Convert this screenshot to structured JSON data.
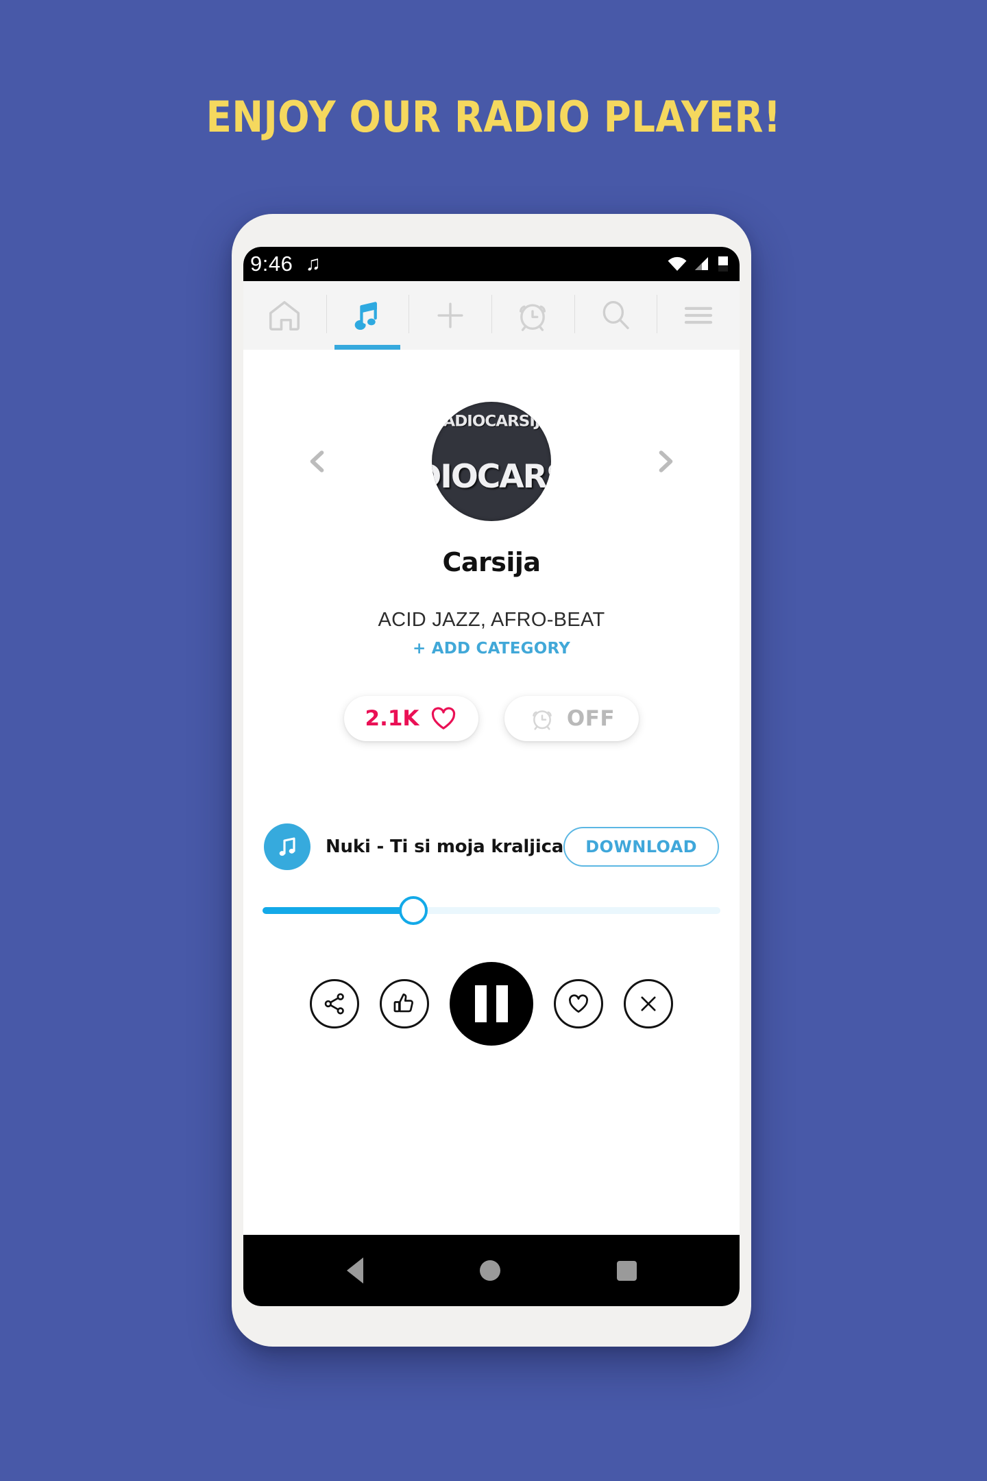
{
  "page": {
    "background_color": "#4859a8",
    "headline": "ENJOY OUR RADIO PLAYER!",
    "headline_color": "#f5d85e"
  },
  "statusbar": {
    "time": "9:46",
    "music_glyph": "♫",
    "icons": [
      "wifi-icon",
      "signal-icon",
      "battery-icon"
    ]
  },
  "tabbar": {
    "accent_color": "#36a9dd",
    "tabs": [
      {
        "name": "home",
        "icon": "home-icon",
        "active": false
      },
      {
        "name": "music",
        "icon": "music-note-icon",
        "active": true
      },
      {
        "name": "add",
        "icon": "plus-icon",
        "active": false
      },
      {
        "name": "alarm",
        "icon": "alarm-clock-icon",
        "active": false
      },
      {
        "name": "search",
        "icon": "search-icon",
        "active": false
      },
      {
        "name": "menu",
        "icon": "hamburger-menu-icon",
        "active": false
      }
    ]
  },
  "station": {
    "artwork_top_text": "RADIOCARSIJA",
    "artwork_main_text": "DIOCARS",
    "name": "Carsija",
    "categories": "ACID JAZZ, AFRO-BEAT",
    "add_category_label": "+ ADD CATEGORY",
    "add_category_color": "#41a8d8",
    "prev_icon": "chevron-left-icon",
    "next_icon": "chevron-right-icon"
  },
  "chips": {
    "like": {
      "count": "2.1K",
      "icon": "heart-outline-icon",
      "color": "#ea1055"
    },
    "alarm": {
      "label": "OFF",
      "icon": "alarm-clock-icon",
      "color": "#b9b9b9"
    }
  },
  "now_playing": {
    "icon": "music-note-circle-icon",
    "icon_color": "#36aadd",
    "title": "Nuki - Ti si moja kraljica",
    "download_label": "DOWNLOAD",
    "download_color": "#3fa7da"
  },
  "slider": {
    "progress_percent": 33,
    "fill_color": "#13a9e8",
    "track_color": "#eaf7fd"
  },
  "controls": [
    {
      "name": "share",
      "icon": "share-icon"
    },
    {
      "name": "thumbs-up",
      "icon": "thumbs-up-icon"
    },
    {
      "name": "pause",
      "icon": "pause-icon"
    },
    {
      "name": "favorite",
      "icon": "heart-outline-icon"
    },
    {
      "name": "close",
      "icon": "close-x-icon"
    }
  ],
  "android_nav": [
    {
      "name": "back",
      "icon": "triangle-back-icon"
    },
    {
      "name": "home",
      "icon": "circle-home-icon"
    },
    {
      "name": "recents",
      "icon": "square-recents-icon"
    }
  ]
}
